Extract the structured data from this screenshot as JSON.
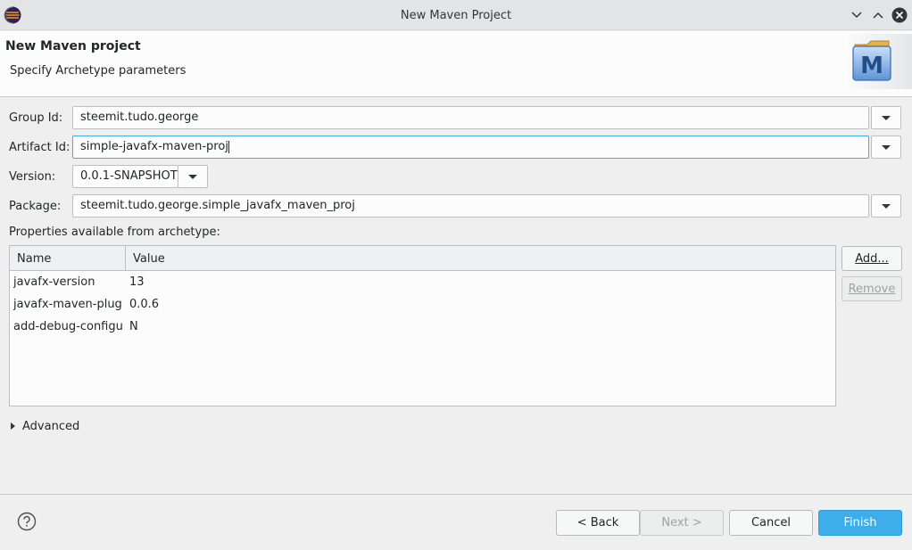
{
  "window": {
    "title": "New Maven Project"
  },
  "banner": {
    "title": "New Maven project",
    "subtitle": "Specify Archetype parameters",
    "logo_letter": "M"
  },
  "form": {
    "group_id": {
      "label": "Group Id:",
      "value": "steemit.tudo.george"
    },
    "artifact_id": {
      "label": "Artifact Id:",
      "value": "simple-javafx-maven-proj"
    },
    "version": {
      "label": "Version:",
      "value": "0.0.1-SNAPSHOT"
    },
    "package": {
      "label": "Package:",
      "value": "steemit.tudo.george.simple_javafx_maven_proj"
    }
  },
  "properties": {
    "label": "Properties available from archetype:",
    "columns": [
      "Name",
      "Value"
    ],
    "rows": [
      {
        "name": "javafx-version",
        "value": "13"
      },
      {
        "name": "javafx-maven-plugin",
        "value": "0.0.6"
      },
      {
        "name": "add-debug-configuration",
        "value": "N"
      }
    ],
    "add_label": "Add...",
    "remove_label": "Remove"
  },
  "advanced": {
    "label": "Advanced"
  },
  "footer": {
    "help_icon": "question-mark-icon",
    "back_label": "< Back",
    "next_label": "Next >",
    "cancel_label": "Cancel",
    "finish_label": "Finish"
  },
  "colors": {
    "accent": "#3daee9",
    "titlebar": "#e3e4e5",
    "background": "#efefef"
  }
}
